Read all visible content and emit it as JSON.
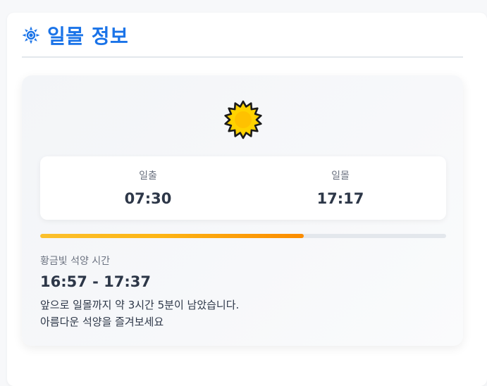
{
  "header": {
    "title": "일몰 정보",
    "icon": "sun-icon",
    "accent_color": "#1a73e8"
  },
  "card": {
    "weather_icon": "sun-icon",
    "sunrise": {
      "label": "일출",
      "time": "07:30"
    },
    "sunset": {
      "label": "일몰",
      "time": "17:17"
    },
    "day_progress_percent": 65,
    "progress_colors": [
      "#fbc02d",
      "#fb8c00"
    ],
    "golden_hour": {
      "label": "황금빛 석양 시간",
      "range": "16:57 - 17:37"
    },
    "message_line1": "앞으로 일몰까지 약 3시간 5분이 남았습니다.",
    "message_line2": "아름다운 석양을 즐겨보세요"
  }
}
